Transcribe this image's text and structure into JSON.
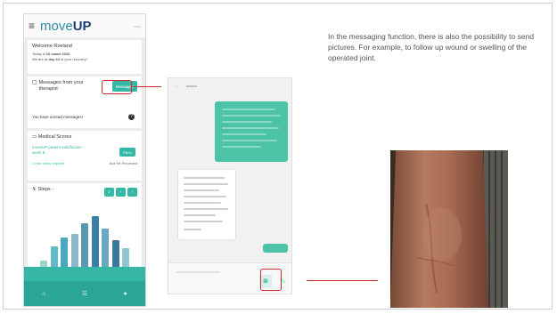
{
  "app": {
    "brand_prefix": "move",
    "brand_suffix": "UP",
    "welcome": {
      "title": "Welcome Roeland",
      "today_prefix": "Today is ",
      "today_date": "16 maart 2020",
      "today_suffix": ".",
      "day_prefix": "We are at ",
      "day_value": "day 44",
      "day_suffix": " of your recovery!"
    },
    "messages": {
      "title": "Messages from your therapist",
      "button": "Messages",
      "unread": "You have unread messages!"
    },
    "scores": {
      "title": "Medical Scores",
      "satisfaction": "moveUP patient satisfaction - week 6",
      "fill_button": "Fill in",
      "video_request": "1 new video request",
      "video_status": "Not Yet Recorded"
    },
    "steps": {
      "title": "Steps -",
      "bar_levels": [
        0.18,
        0.42,
        0.55,
        0.62,
        0.78,
        0.9,
        0.7,
        0.52,
        0.38
      ]
    }
  },
  "description": "In the messaging function, there is also the possibility to send pictures. For example, to follow up wound or swelling of the operated joint.",
  "colors": {
    "accent": "#36b7a6",
    "brand_dark": "#1b3d74",
    "highlight": "#d12c2c",
    "chat_out": "#4cc2a7"
  },
  "icons": [
    "hamburger-icon",
    "message-icon",
    "folder-icon",
    "steps-icon",
    "camera-icon",
    "microphone-icon"
  ]
}
